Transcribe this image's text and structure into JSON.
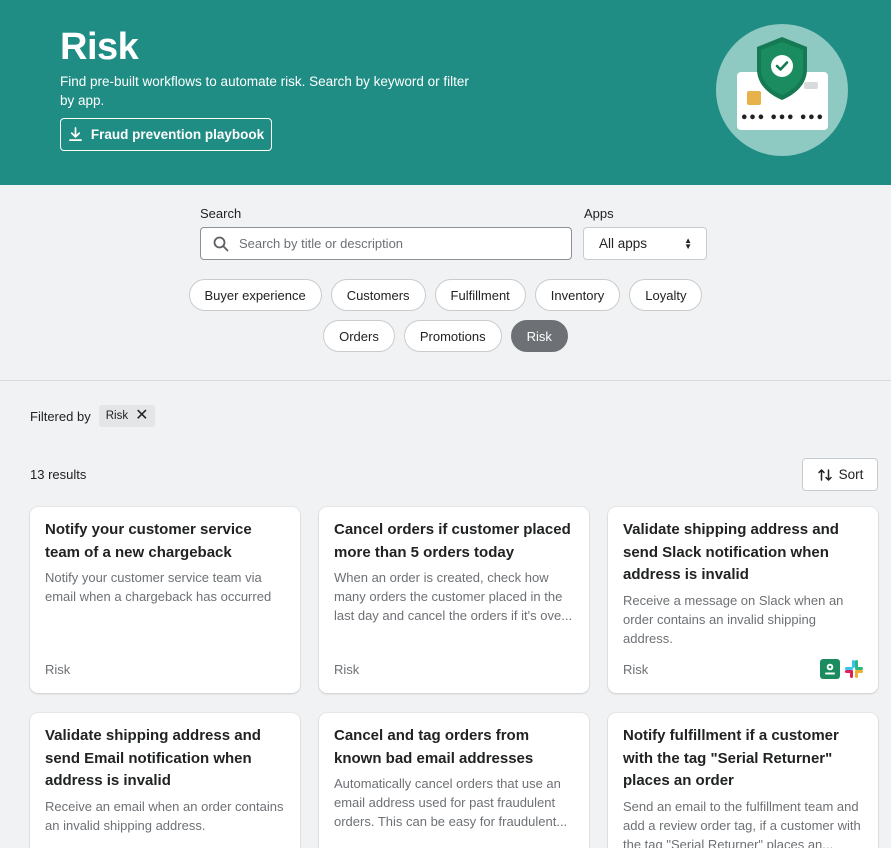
{
  "header": {
    "title": "Risk",
    "description": "Find pre-built workflows to automate risk. Search by keyword or filter by app.",
    "playbook_label": "Fraud prevention playbook",
    "colors": {
      "background": "#208d85",
      "illustration_circle": "#8ec9c2"
    }
  },
  "search": {
    "label": "Search",
    "placeholder": "Search by title or description",
    "value": ""
  },
  "apps": {
    "label": "Apps",
    "selected": "All apps"
  },
  "categories": {
    "row1": [
      "Buyer experience",
      "Customers",
      "Fulfillment",
      "Inventory",
      "Loyalty"
    ],
    "row2": [
      "Orders",
      "Promotions",
      "Risk"
    ],
    "active": "Risk"
  },
  "filter": {
    "label": "Filtered by",
    "tag": "Risk"
  },
  "results": {
    "count": "13 results",
    "sort_label": "Sort"
  },
  "cards": [
    {
      "title": "Notify your customer service team of a new chargeback",
      "description": "Notify your customer service team via email when a chargeback has occurred",
      "category": "Risk",
      "apps": []
    },
    {
      "title": "Cancel orders if customer placed more than 5 orders today",
      "description": "When an order is created, check how many orders the customer placed in the last day and cancel the orders if it's ove...",
      "category": "Risk",
      "apps": []
    },
    {
      "title": "Validate shipping address and send Slack notification when address is invalid",
      "description": "Receive a message on Slack when an order contains an invalid shipping address.",
      "category": "Risk",
      "apps": [
        "address-validator-icon",
        "slack-icon"
      ]
    },
    {
      "title": "Validate shipping address and send Email notification when address is invalid",
      "description": "Receive an email when an order contains an invalid shipping address.",
      "category": "",
      "apps": []
    },
    {
      "title": "Cancel and tag orders from known bad email addresses",
      "description": "Automatically cancel orders that use an email address used for past fraudulent orders. This can be easy for fraudulent...",
      "category": "",
      "apps": []
    },
    {
      "title": "Notify fulfillment if a customer with the tag \"Serial Returner\" places an order",
      "description": "Send an email to the fulfillment team and add a review order tag, if a customer with the tag \"Serial Returner\" places an...",
      "category": "",
      "apps": []
    }
  ]
}
